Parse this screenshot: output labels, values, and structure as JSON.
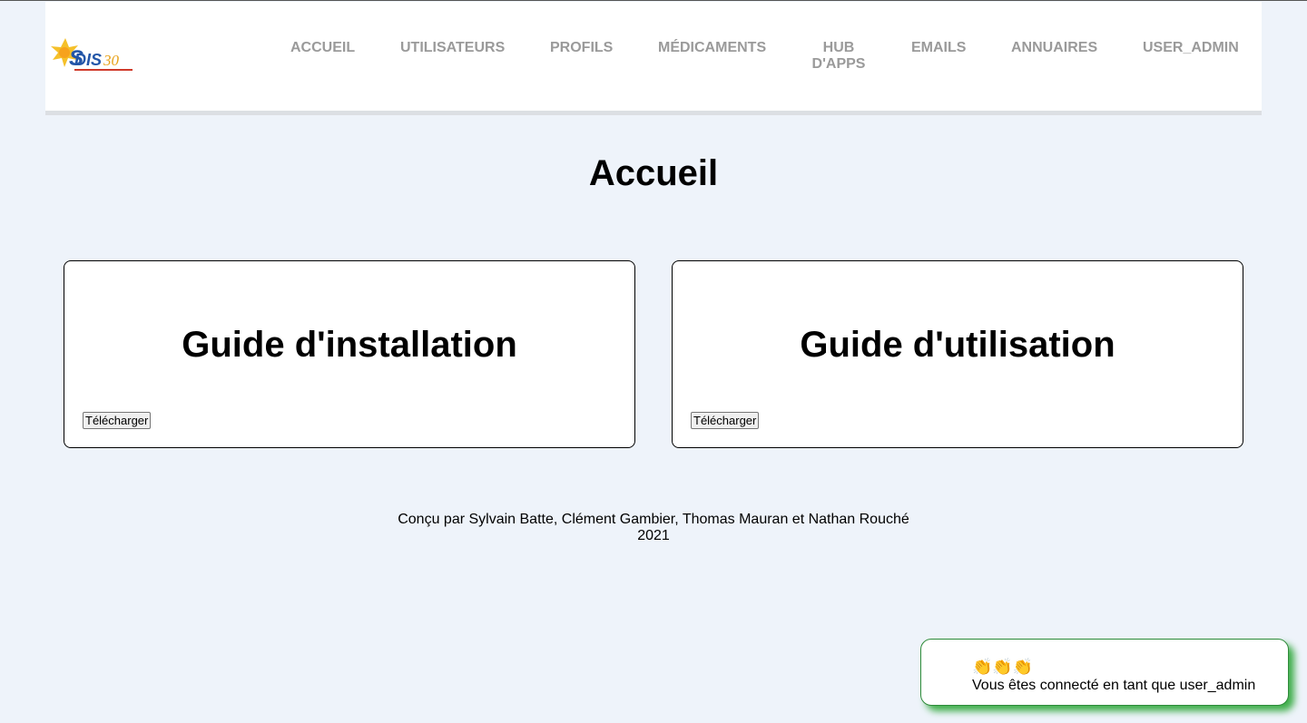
{
  "header": {
    "logo_text": "SDIS30",
    "nav": [
      {
        "label": "ACCUEIL"
      },
      {
        "label": "UTILISATEURS"
      },
      {
        "label": "PROFILS"
      },
      {
        "label": "MÉDICAMENTS"
      },
      {
        "label": "HUB D'APPS"
      },
      {
        "label": "EMAILS"
      },
      {
        "label": "ANNUAIRES"
      },
      {
        "label": "USER_ADMIN"
      }
    ]
  },
  "page": {
    "title": "Accueil"
  },
  "cards": [
    {
      "title": "Guide d'installation",
      "button_label": "Télécharger"
    },
    {
      "title": "Guide d'utilisation",
      "button_label": "Télécharger"
    }
  ],
  "footer": {
    "credits": "Conçu par Sylvain Batte, Clément Gambier, Thomas Mauran et Nathan Rouché",
    "year": "2021"
  },
  "toast": {
    "emoji": "👏👏👏",
    "message": "Vous êtes connecté en tant que user_admin"
  },
  "colors": {
    "background": "#eef3fa",
    "nav_text": "#9a9a9a",
    "toast_accent": "#2e8b3a"
  }
}
